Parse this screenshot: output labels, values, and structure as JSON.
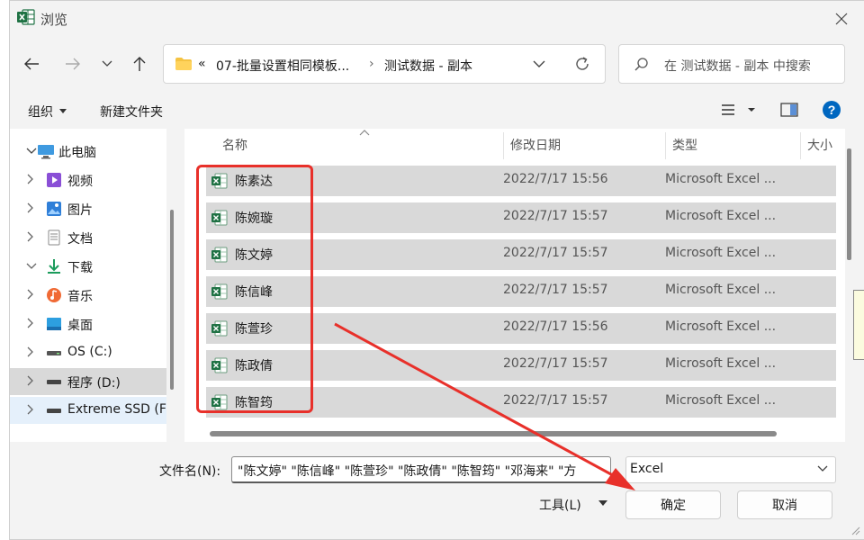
{
  "window": {
    "title": "浏览"
  },
  "address": {
    "overflow": "«",
    "crumbs": [
      "07-批量设置相同模板...",
      "测试数据 - 副本"
    ],
    "separator": "›"
  },
  "search": {
    "placeholder": "在 测试数据 - 副本 中搜索"
  },
  "toolbar": {
    "organize": "组织",
    "new_folder": "新建文件夹"
  },
  "sidebar": {
    "items": [
      {
        "label": "此电脑",
        "icon": "pc-icon"
      },
      {
        "label": "视频",
        "icon": "video-icon"
      },
      {
        "label": "图片",
        "icon": "pictures-icon"
      },
      {
        "label": "文档",
        "icon": "documents-icon"
      },
      {
        "label": "下载",
        "icon": "download-icon"
      },
      {
        "label": "音乐",
        "icon": "music-icon"
      },
      {
        "label": "桌面",
        "icon": "desktop-icon"
      },
      {
        "label": "OS (C:)",
        "icon": "drive-icon"
      },
      {
        "label": "程序 (D:)",
        "icon": "drive-icon"
      },
      {
        "label": "Extreme SSD (F",
        "icon": "drive-icon"
      }
    ]
  },
  "columns": {
    "name": "名称",
    "modified": "修改日期",
    "type": "类型",
    "size": "大小"
  },
  "files": [
    {
      "name": "陈素达",
      "modified": "2022/7/17 15:56",
      "type": "Microsoft Excel ..."
    },
    {
      "name": "陈婉璇",
      "modified": "2022/7/17 15:57",
      "type": "Microsoft Excel ..."
    },
    {
      "name": "陈文婷",
      "modified": "2022/7/17 15:57",
      "type": "Microsoft Excel ..."
    },
    {
      "name": "陈信峰",
      "modified": "2022/7/17 15:57",
      "type": "Microsoft Excel ..."
    },
    {
      "name": "陈萱珍",
      "modified": "2022/7/17 15:56",
      "type": "Microsoft Excel ..."
    },
    {
      "name": "陈政倩",
      "modified": "2022/7/17 15:57",
      "type": "Microsoft Excel ..."
    },
    {
      "name": "陈智筠",
      "modified": "2022/7/17 15:57",
      "type": "Microsoft Excel ..."
    }
  ],
  "bottom": {
    "filename_label": "文件名(N):",
    "filename_value": "\"陈文婷\" \"陈信峰\" \"陈萱珍\" \"陈政倩\" \"陈智筠\" \"邓海来\" \"方",
    "filetype": "Excel",
    "tools": "工具(L)",
    "ok": "确定",
    "cancel": "取消"
  },
  "colors": {
    "annotation": "#e8302a",
    "excel_green": "#1f7244",
    "accent": "#0067c0"
  }
}
